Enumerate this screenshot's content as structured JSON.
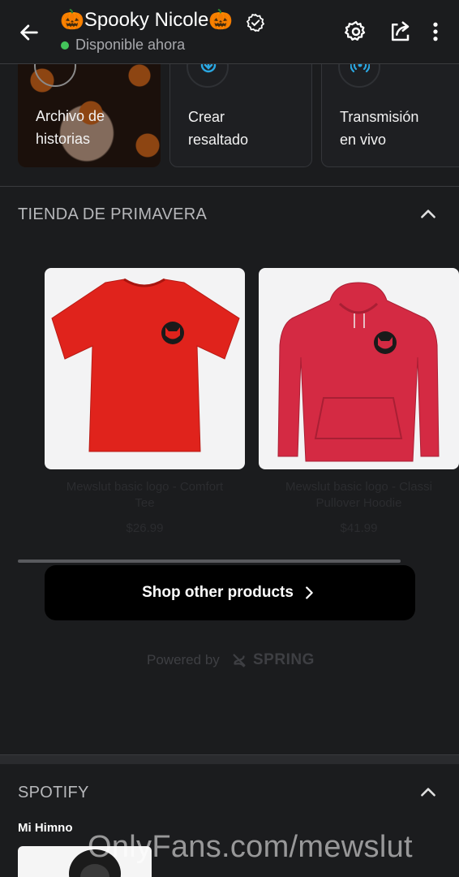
{
  "header": {
    "title": "🎃Spooky Nicole🎃",
    "status": "Disponible ahora",
    "status_color": "#43c45a"
  },
  "highlights": [
    {
      "label_line1": "Archivo de",
      "label_line2": "historias"
    },
    {
      "label_line1": "Crear",
      "label_line2": "resaltado",
      "icon": "add-highlight-icon"
    },
    {
      "label_line1": "Transmisión",
      "label_line2": "en vivo",
      "icon": "live-broadcast-icon"
    }
  ],
  "shop": {
    "title": "TIENDA DE PRIMAVERA",
    "products": [
      {
        "name_line1": "Mewslut basic logo - Comfort",
        "name_line2": "Tee",
        "price": "$26.99",
        "color": "#e0231c"
      },
      {
        "name_line1": "Mewslut basic logo - Classi",
        "name_line2": "Pullover Hoodie",
        "price": "$41.99",
        "color": "#d42a43"
      }
    ],
    "button_label": "Shop other products",
    "powered_by": "Powered by",
    "brand": "SPRING"
  },
  "spotify": {
    "title": "SPOTIFY",
    "playlist": "Mi Himno"
  },
  "watermark": "OnlyFans.com/mewslut",
  "colors": {
    "background": "#1b1c1e",
    "accent": "#2aa6e0"
  }
}
